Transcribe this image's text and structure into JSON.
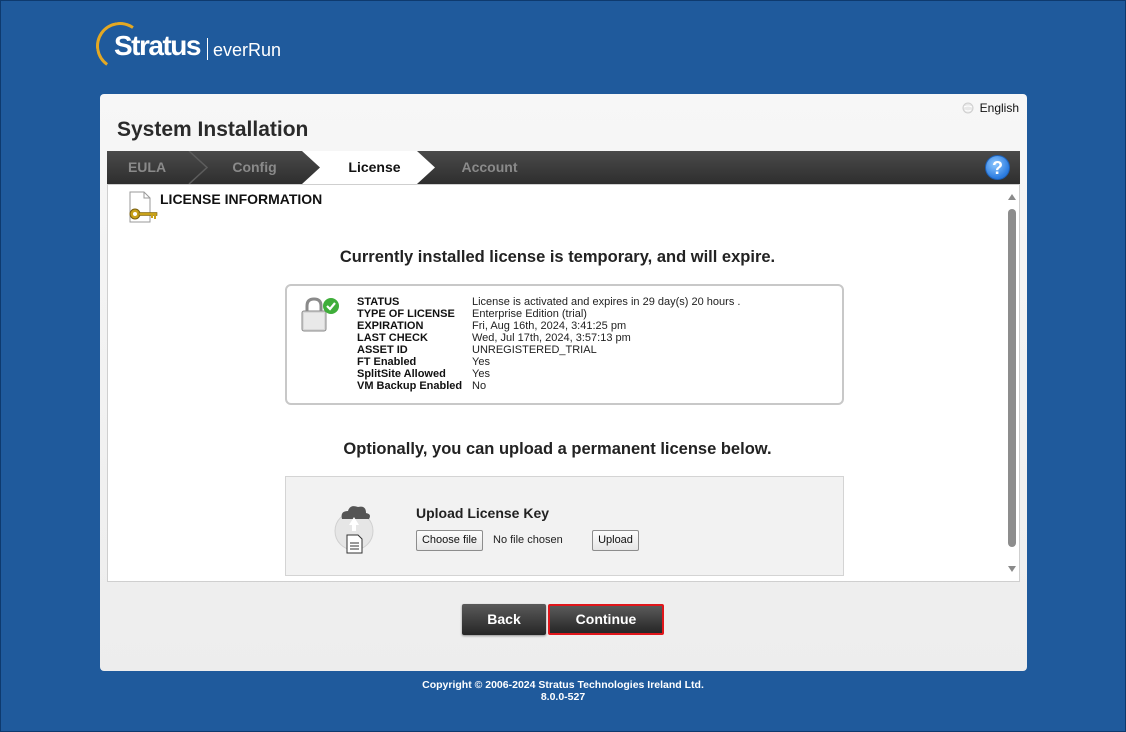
{
  "brand": {
    "company": "Stratus",
    "product": "everRun"
  },
  "language": {
    "label": "English",
    "icon": "globe-icon"
  },
  "title": "System Installation",
  "wizard": {
    "steps": [
      {
        "label": "EULA",
        "state": "done"
      },
      {
        "label": "Config",
        "state": "done"
      },
      {
        "label": "License",
        "state": "active"
      },
      {
        "label": "Account",
        "state": "pending"
      }
    ],
    "help_label": "?"
  },
  "section": {
    "title": "LICENSE INFORMATION",
    "icon": "license-key-icon"
  },
  "notice": "Currently installed license is temporary, and will expire.",
  "license": {
    "icon": "lock-check-icon",
    "rows": [
      {
        "key": "STATUS",
        "value": "License is activated and expires in 29 day(s) 20 hours ."
      },
      {
        "key": "TYPE OF LICENSE",
        "value": "Enterprise Edition (trial)"
      },
      {
        "key": "EXPIRATION",
        "value": "Fri, Aug 16th, 2024, 3:41:25 pm"
      },
      {
        "key": "LAST CHECK",
        "value": "Wed, Jul 17th, 2024, 3:57:13 pm"
      },
      {
        "key": "ASSET ID",
        "value": "UNREGISTERED_TRIAL"
      },
      {
        "key": "FT Enabled",
        "value": "Yes"
      },
      {
        "key": "SplitSite Allowed",
        "value": "Yes"
      },
      {
        "key": "VM Backup Enabled",
        "value": "No"
      }
    ]
  },
  "upload_prompt": "Optionally, you can upload a permanent license below.",
  "upload": {
    "icon": "cloud-upload-icon",
    "title": "Upload License Key",
    "choose_label": "Choose file",
    "file_status": "No file chosen",
    "upload_label": "Upload"
  },
  "buttons": {
    "back": "Back",
    "continue": "Continue"
  },
  "footer": {
    "copyright": "Copyright © 2006-2024 Stratus Technologies Ireland Ltd.",
    "version": "8.0.0-527"
  },
  "colors": {
    "background": "#1f5a9c",
    "accent": "#e3a823",
    "highlight": "#e0161b"
  }
}
